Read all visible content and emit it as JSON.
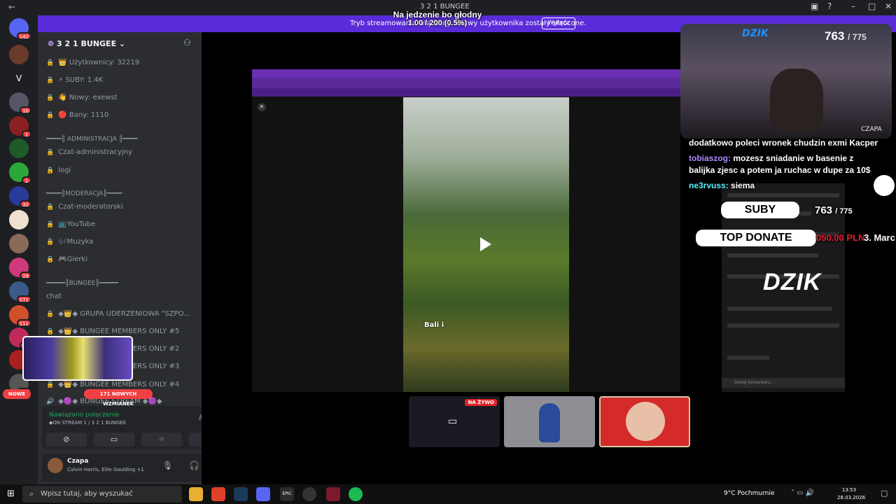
{
  "window": {
    "title": "3 2 1 BUNGEE",
    "back": "←"
  },
  "overlay_top": {
    "line1": "Na jedzenie bo głodny",
    "line2": "1.00 / 200 (0.5%)"
  },
  "banner": {
    "message": "Tryb streamowania włączony. Nazwy użytkownika zostały skrócone.",
    "button": "Wyłącz"
  },
  "rail": {
    "badges": [
      "142",
      "10",
      "1",
      "1",
      "32",
      "29",
      "171",
      "111",
      "14",
      "744"
    ],
    "new_label": "NOWE",
    "server_letter": "V"
  },
  "sidebar": {
    "server_name": "3 2 1 BUNGEE",
    "info_channels": [
      "Użytkownicy: 32219",
      "SUBY: 1.4K",
      "Nowy: exewst",
      "Bany: 1110"
    ],
    "info_emojis": [
      "👑",
      "⚡",
      "👋",
      "🔴"
    ],
    "cat_admin": "━━━━║ ADMINISTRACJA ║━━━━",
    "admin_channels": [
      "Czat-administracyjny",
      "logi"
    ],
    "cat_mod": "━━━━║MODERACJA║━━━━",
    "mod_channels": [
      "Czat-moderatorski",
      "YouTube",
      "Muzyka",
      "Gierki"
    ],
    "mod_emojis": [
      "",
      "📺",
      "🎶",
      "🎮"
    ],
    "cat_bungee": "━━━━━║BUNGEE║━━━━━",
    "bungee_channels": [
      "chat",
      "◆👑◆ GRUPA UDERZENIOWA \"SZPO...",
      "◆👑◆ BUNGEE MEMBERS ONLY #5",
      "◆👑◆ BUNGEE MEMBERS ONLY #2",
      "◆👑◆ BUNGEE MEMBERS ONLY #3",
      "◆👑◆ BUNGEE MEMBERS ONLY #4",
      "◆🟣◆ BUNGEE STREAM ◆🟣◆"
    ],
    "changes_label": "171 NOWYCH WZMIANEK"
  },
  "voice": {
    "status": "Nawiązano połączenie",
    "channel": "◆ON STREAM 1 / 3 2 1 BUNGEE"
  },
  "user": {
    "name": "Czapa",
    "activity": "Calvin Harris, Ellie Goulding +1"
  },
  "stream": {
    "caption": "Bali i",
    "comment_input": "Dodaj komentarz..."
  },
  "cam": {
    "count": "763",
    "total": "/ 775",
    "name": "CZAPA",
    "logo": "DZIK"
  },
  "chat": [
    {
      "user": "",
      "text": "dodatkowo poleci wronek chudzin exmi Kacper"
    },
    {
      "user": "tobiaszog:",
      "text": "mozesz sniadanie w basenie z"
    },
    {
      "user": "",
      "text": "balijka zjesc a potem ja ruchac w dupe za 10$"
    },
    {
      "user": "ne3rvuss:",
      "text": "siema"
    }
  ],
  "stats": {
    "suby_label": "SUBY",
    "suby_count": "763",
    "suby_total": "/ 775",
    "donate_label": "TOP DONATE",
    "donate_amount": "050.00 PLN",
    "donate_user": "3. Marc",
    "brand": "DZIK"
  },
  "tiles": {
    "live": "NA ŻYWO"
  },
  "taskbar": {
    "search": "Wpisz tutaj, aby wyszukać",
    "weather": "9°C  Pochmurnie",
    "time": "13:53",
    "date": "28.03.2026"
  },
  "colors": {
    "accent": "#5a2bd8",
    "online": "#23a55a",
    "danger": "#f23f43"
  }
}
